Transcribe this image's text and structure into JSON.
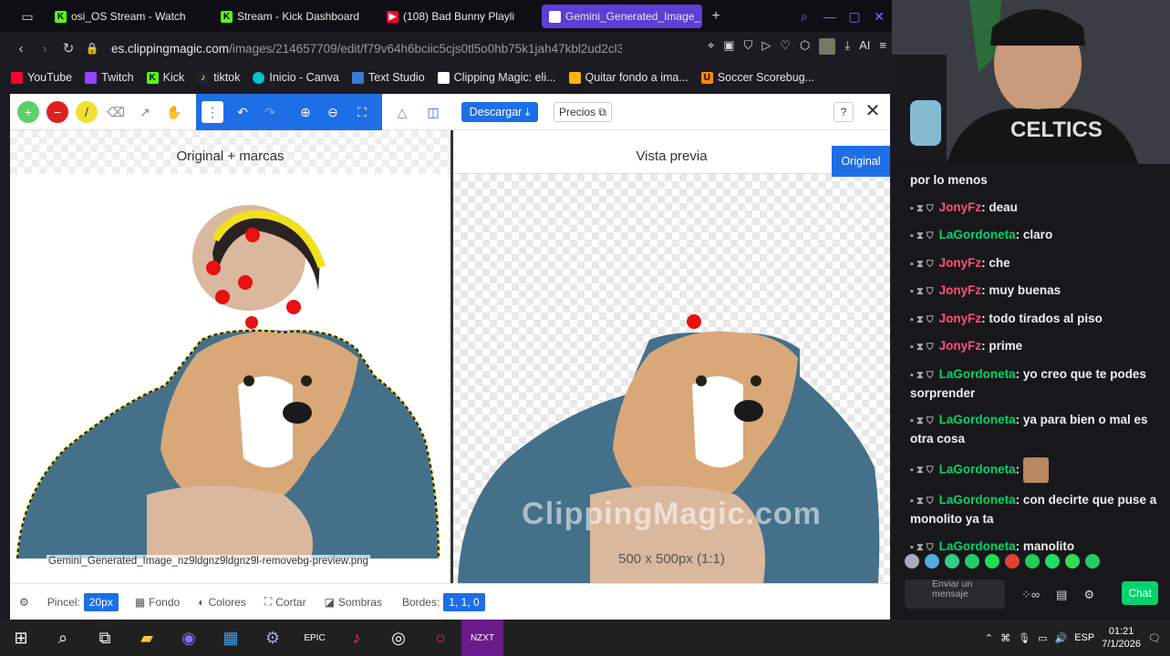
{
  "tabs": [
    {
      "label": "osi_OS Stream - Watch",
      "color": "#53fc18"
    },
    {
      "label": "Stream - Kick Dashboard",
      "color": "#53fc18"
    },
    {
      "label": "(108) Bad Bunny Playli",
      "color": "#ff0033"
    },
    {
      "label": "Gemini_Generated_Image_",
      "color": "#ffffff"
    }
  ],
  "url": {
    "host": "es.clippingmagic.com",
    "path": "/images/214657709/edit/f79v64h6bciic5cjs0tl5o0hb75k1jah47kbl2ud2cl3h"
  },
  "url_tools": {
    "ai": "AI"
  },
  "bookmarks": [
    "YouTube",
    "Twitch",
    "Kick",
    "tiktok",
    "Inicio - Canva",
    "Text Studio",
    "Clipping Magic: eli...",
    "Quitar fondo a ima...",
    "Soccer Scorebug..."
  ],
  "toolbar": {
    "download": "Descargar",
    "prices": "Precios",
    "help": "?"
  },
  "panes": {
    "left_title": "Original + marcas",
    "right_title": "Vista previa",
    "original_btn": "Original",
    "filename": "Gemini_Generated_Image_nz9ldgnz9ldgnz9l-removebg-preview.png",
    "watermark": "ClippingMagic.com",
    "dimensions": "500 x 500px (1:1)"
  },
  "bottombar": {
    "brush_label": "Pincel:",
    "brush_value": "20px",
    "bg": "Fondo",
    "colors": "Colores",
    "crop": "Cortar",
    "shadows": "Sombras",
    "edges_label": "Bordes:",
    "edges_value": "1, 1, 0"
  },
  "chat": {
    "messages": [
      {
        "user": "",
        "text": "por lo menos",
        "color": "#ff4f7b"
      },
      {
        "user": "JonyFz",
        "text": ": deau",
        "color": "#ff4f7b"
      },
      {
        "user": "LaGordoneta",
        "text": ": claro",
        "color": "#00d36b"
      },
      {
        "user": "JonyFz",
        "text": ": che",
        "color": "#ff4f7b"
      },
      {
        "user": "JonyFz",
        "text": ": muy buenas",
        "color": "#ff4f7b"
      },
      {
        "user": "JonyFz",
        "text": ": todo tirados al piso",
        "color": "#ff4f7b"
      },
      {
        "user": "JonyFz",
        "text": ": prime",
        "color": "#ff4f7b"
      },
      {
        "user": "LaGordoneta",
        "text": ": yo creo que te podes sorprender",
        "color": "#00d36b"
      },
      {
        "user": "LaGordoneta",
        "text": ": ya para bien o mal es otra cosa",
        "color": "#00d36b"
      },
      {
        "user": "LaGordoneta",
        "text": ":",
        "color": "#00d36b"
      },
      {
        "user": "LaGordoneta",
        "text": ": con decirte que puse a monolito ya ta",
        "color": "#00d36b"
      },
      {
        "user": "LaGordoneta",
        "text": ": manolito",
        "color": "#00d36b"
      }
    ],
    "input_placeholder": "Enviar un mensaje",
    "send": "Chat"
  },
  "taskbar": {
    "lang": "ESP",
    "time": "01:21",
    "date": "7/1/2026"
  }
}
